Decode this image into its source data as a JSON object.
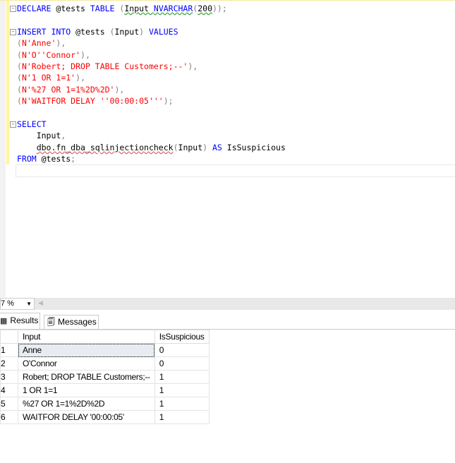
{
  "editor": {
    "lines": [
      [
        [
          "kw",
          "DECLARE "
        ],
        [
          "fn",
          "@tests "
        ],
        [
          "kw",
          "TABLE "
        ],
        [
          "gr",
          "("
        ],
        [
          "sqg",
          "Input "
        ],
        [
          "sqgk",
          "NVARCHAR"
        ],
        [
          "gr",
          "("
        ],
        [
          "sqg",
          "200"
        ],
        [
          "gr",
          "));"
        ]
      ],
      [],
      [
        [
          "kw",
          "INSERT INTO "
        ],
        [
          "fn",
          "@tests "
        ],
        [
          "gr",
          "("
        ],
        [
          "fn",
          "Input"
        ],
        [
          "gr",
          ") "
        ],
        [
          "kw",
          "VALUES"
        ]
      ],
      [
        [
          "gr",
          "("
        ],
        [
          "str",
          "N'Anne'"
        ],
        [
          "gr",
          "),"
        ]
      ],
      [
        [
          "gr",
          "("
        ],
        [
          "str",
          "N'O''Connor'"
        ],
        [
          "gr",
          "),"
        ]
      ],
      [
        [
          "gr",
          "("
        ],
        [
          "str",
          "N'Robert; DROP TABLE Customers;--'"
        ],
        [
          "gr",
          "),"
        ]
      ],
      [
        [
          "gr",
          "("
        ],
        [
          "str",
          "N'1 OR 1=1'"
        ],
        [
          "gr",
          "),"
        ]
      ],
      [
        [
          "gr",
          "("
        ],
        [
          "str",
          "N'%27 OR 1=1%2D%2D'"
        ],
        [
          "gr",
          "),"
        ]
      ],
      [
        [
          "gr",
          "("
        ],
        [
          "str",
          "N'WAITFOR DELAY ''00:00:05'''"
        ],
        [
          "gr",
          ");"
        ]
      ],
      [],
      [
        [
          "kw",
          "SELECT"
        ]
      ],
      [
        [
          "fn",
          "    Input"
        ],
        [
          "gr",
          ","
        ]
      ],
      [
        [
          "fn",
          "    "
        ],
        [
          "sq",
          "dbo.fn_dba_sqlinjectioncheck"
        ],
        [
          "gr",
          "("
        ],
        [
          "fn",
          "Input"
        ],
        [
          "gr",
          ") "
        ],
        [
          "kw",
          "AS "
        ],
        [
          "fn",
          "IsSuspicious"
        ]
      ],
      [
        [
          "kw",
          "FROM "
        ],
        [
          "fn",
          "@tests"
        ],
        [
          "gr",
          ";"
        ]
      ]
    ],
    "folds": [
      0,
      2,
      10
    ]
  },
  "zoom": {
    "value": "7 %"
  },
  "tabs": [
    {
      "label": "Results",
      "icon": "grid-icon"
    },
    {
      "label": "Messages",
      "icon": "messages-icon"
    }
  ],
  "grid": {
    "columns": [
      "Input",
      "IsSuspicious"
    ],
    "rows": [
      {
        "n": "1",
        "input": "Anne",
        "sus": "0"
      },
      {
        "n": "2",
        "input": "O'Connor",
        "sus": "0"
      },
      {
        "n": "3",
        "input": "Robert; DROP TABLE Customers;--",
        "sus": "1"
      },
      {
        "n": "4",
        "input": "1 OR 1=1",
        "sus": "1"
      },
      {
        "n": "5",
        "input": "%27 OR 1=1%2D%2D",
        "sus": "1"
      },
      {
        "n": "6",
        "input": "WAITFOR DELAY '00:00:05'",
        "sus": "1"
      }
    ]
  }
}
